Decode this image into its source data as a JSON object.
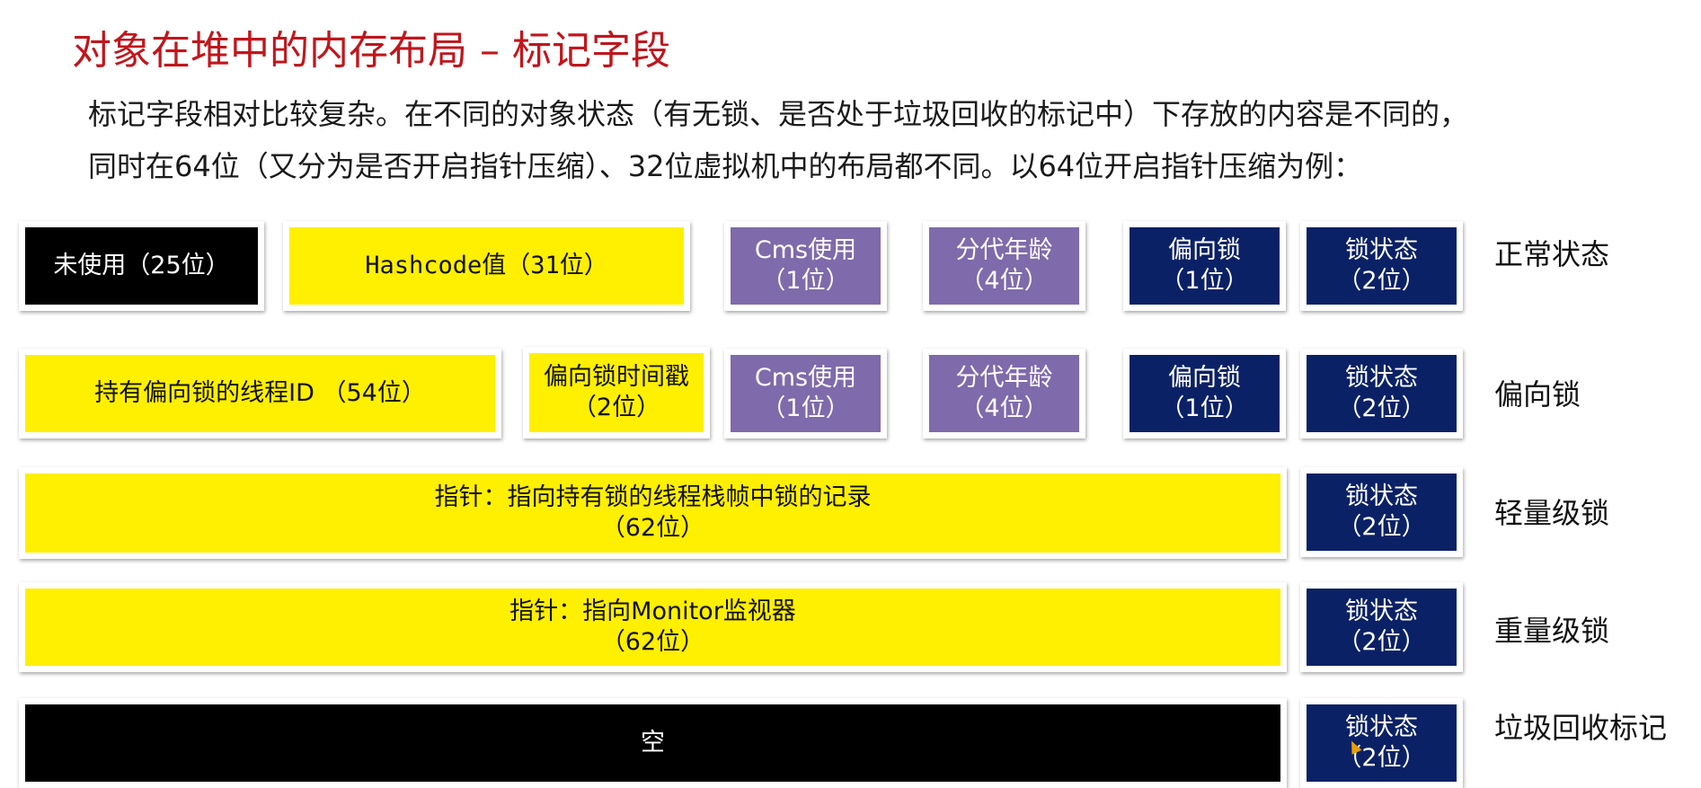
{
  "title": "对象在堆中的内存布局 – 标记字段",
  "paragraph": {
    "line1": "标记字段相对比较复杂。在不同的对象状态（有无锁、是否处于垃圾回收的标记中）下存放的内容是不同的，",
    "line2": "同时在64位（又分为是否开启指针压缩）、32位虚拟机中的布局都不同。以64位开启指针压缩为例："
  },
  "rows": [
    {
      "state": "正常状态",
      "cells": [
        {
          "line1": "未使用（25位）",
          "line2": ""
        },
        {
          "line1": "Hashcode值（31位）",
          "line2": ""
        },
        {
          "line1": "Cms使用",
          "line2": "（1位）"
        },
        {
          "line1": "分代年龄",
          "line2": "（4位）"
        },
        {
          "line1": "偏向锁",
          "line2": "（1位）"
        },
        {
          "line1": "锁状态",
          "line2": "（2位）"
        }
      ]
    },
    {
      "state": "偏向锁",
      "cells": [
        {
          "line1": "持有偏向锁的线程ID （54位）",
          "line2": ""
        },
        {
          "line1": "偏向锁时间戳",
          "line2": "（2位）"
        },
        {
          "line1": "Cms使用",
          "line2": "（1位）"
        },
        {
          "line1": "分代年龄",
          "line2": "（4位）"
        },
        {
          "line1": "偏向锁",
          "line2": "（1位）"
        },
        {
          "line1": "锁状态",
          "line2": "（2位）"
        }
      ]
    },
    {
      "state": "轻量级锁",
      "cells": [
        {
          "line1": "指针：指向持有锁的线程栈帧中锁的记录",
          "line2": "（62位）"
        },
        {
          "line1": "锁状态",
          "line2": "（2位）"
        }
      ]
    },
    {
      "state": "重量级锁",
      "cells": [
        {
          "line1": "指针：指向Monitor监视器",
          "line2": "（62位）"
        },
        {
          "line1": "锁状态",
          "line2": "（2位）"
        }
      ]
    },
    {
      "state": "垃圾回收标记",
      "cells": [
        {
          "line1": "空",
          "line2": ""
        },
        {
          "line1": "锁状态",
          "line2": "（2位）"
        }
      ]
    }
  ],
  "colors": {
    "title": "#c0161c",
    "black": "#000000",
    "yellow": "#ffef00",
    "purple": "#7f6aab",
    "navy": "#0b2166"
  }
}
